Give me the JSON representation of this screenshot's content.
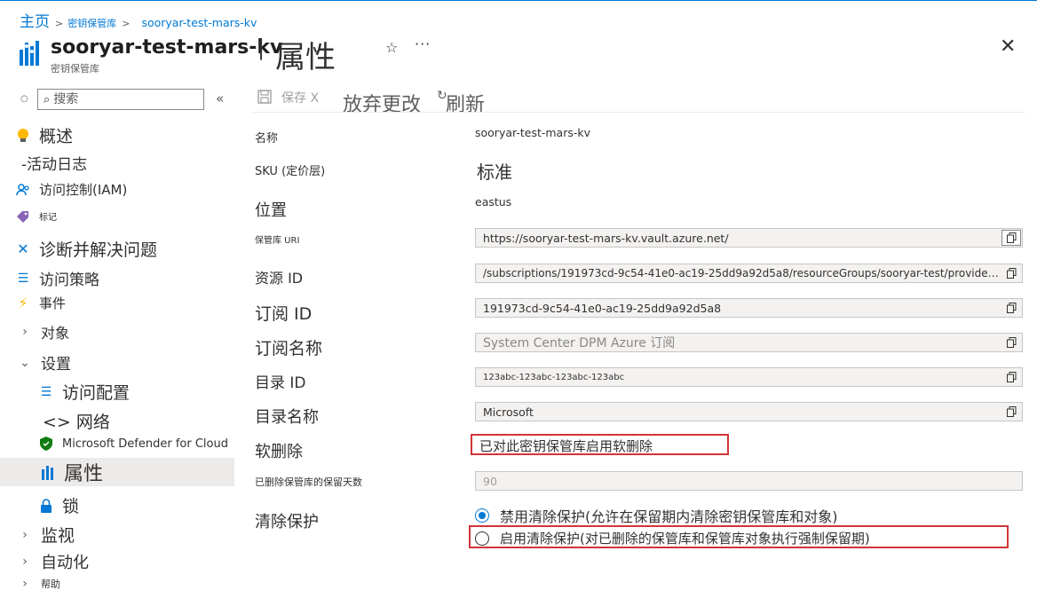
{
  "breadcrumb": {
    "home": "主页",
    "vaults": "密钥保管库",
    "current": "sooryar-test-mars-kv"
  },
  "header": {
    "resource_name": "sooryar-test-mars-kv",
    "resource_type": "密钥保管库",
    "page_title": "属性"
  },
  "search": {
    "placeholder": "搜索"
  },
  "sidebar": {
    "items": [
      {
        "label": "概述",
        "icon": "lightbulb-icon"
      },
      {
        "label": "-活动日志",
        "icon": ""
      },
      {
        "label": "访问控制(IAM)",
        "icon": "people-icon"
      },
      {
        "label": "标记",
        "icon": "tag-icon"
      },
      {
        "label": "诊断并解决问题",
        "icon": "wrench-icon"
      },
      {
        "label": "访问策略",
        "icon": "list-icon"
      },
      {
        "label": "事件",
        "icon": "lightning-icon"
      },
      {
        "label": "对象",
        "icon": "chevron-right-icon"
      },
      {
        "label": "设置",
        "icon": "chevron-down-icon"
      },
      {
        "label": "访问配置",
        "icon": "list-icon"
      },
      {
        "label": "<> 网络",
        "icon": ""
      },
      {
        "label": "Microsoft Defender for Cloud",
        "icon": "shield-icon"
      },
      {
        "label": "属性",
        "icon": "bars-icon"
      },
      {
        "label": "锁",
        "icon": "lock-icon"
      },
      {
        "label": "监视",
        "icon": "chevron-right-icon"
      },
      {
        "label": "自动化",
        "icon": "chevron-right-icon"
      },
      {
        "label": "帮助",
        "icon": "chevron-right-icon"
      }
    ]
  },
  "toolbar": {
    "save_label": "保存",
    "discard_label": "放弃更改",
    "refresh_label": "刷新"
  },
  "properties": {
    "name_label": "名称",
    "name_value": "sooryar-test-mars-kv",
    "sku_label": "SKU (定价层)",
    "sku_value": "标准",
    "location_label": "位置",
    "location_value": "eastus",
    "uri_label": "保管库 URI",
    "uri_value": "https://sooryar-test-mars-kv.vault.azure.net/",
    "resource_id_label": "资源 ID",
    "resource_id_value": "/subscriptions/191973cd-9c54-41e0-ac19-25dd9a92d5a8/resourceGroups/sooryar-test/providers/...",
    "subscription_id_label": "订阅 ID",
    "subscription_id_value": "191973cd-9c54-41e0-ac19-25dd9a92d5a8",
    "subscription_name_label": "订阅名称",
    "subscription_name_value": "System Center DPM Azure 订阅",
    "directory_id_label": "目录 ID",
    "directory_id_value": "123abc-123abc-123abc-123abc",
    "directory_name_label": "目录名称",
    "directory_name_value": "Microsoft",
    "soft_delete_label": "软删除",
    "soft_delete_value": "已对此密钥保管库启用软删除",
    "retention_label": "已删除保管库的保留天数",
    "retention_value": "90",
    "purge_label": "清除保护",
    "purge_disable_option": "禁用清除保护(允许在保留期内清除密钥保管库和对象)",
    "purge_enable_option": "启用清除保护(对已删除的保管库和保管库对象执行强制保留期)"
  },
  "colors": {
    "accent": "#0078d4",
    "highlight": "#d13438"
  }
}
